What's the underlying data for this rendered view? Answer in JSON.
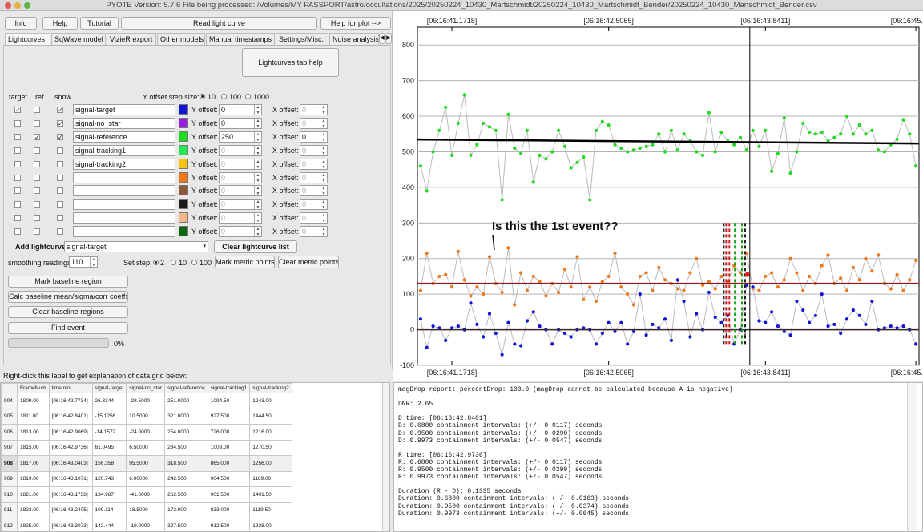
{
  "window": {
    "title": "PYOTE Version: 5.7.6  File being processed: /Volumes/MY PASSPORT/astro/occultations/2025/20250224_10430_Martschmidt/20250224_10430_Martschmidt_Bender/20250224_10430_Martschmidt_Bender.csv"
  },
  "toolbar": {
    "info": "Info",
    "help": "Help",
    "tutorial": "Tutorial",
    "read_lightcurve": "Read light curve",
    "help_for_plot": "Help for plot -->"
  },
  "tabs": [
    "Lightcurves",
    "SqWave model",
    "VizieR export",
    "Other models",
    "Manual timestamps",
    "Settings/Misc.",
    "Noise analysis/"
  ],
  "lightcurves_help": "Lightcurves tab help",
  "headers": {
    "target": "target",
    "ref": "ref",
    "show": "show",
    "y_offset_step": "Y offset step size:"
  },
  "y_step_options": [
    "10",
    "100",
    "1000"
  ],
  "rows": [
    {
      "name": "signal-target",
      "color": "#1414d8",
      "y_label": "Y offset:",
      "y": "0",
      "x_label": "X offset:",
      "x": "0",
      "target": true,
      "ref": false,
      "show": true
    },
    {
      "name": "signal-no_star",
      "color": "#9a1ee0",
      "y_label": "Y offset:",
      "y": "0",
      "x_label": "X offset:",
      "x": "0",
      "target": false,
      "ref": false,
      "show": true
    },
    {
      "name": "signal-reference",
      "color": "#1cdc1c",
      "y_label": "Y offset:",
      "y": "250",
      "x_label": "X offset:",
      "x": "0",
      "target": false,
      "ref": true,
      "show": true
    },
    {
      "name": "signal-tracking1",
      "color": "#22e855",
      "y_label": "Y offset:",
      "y": "0",
      "x_label": "X offset:",
      "x": "0",
      "target": false,
      "ref": false,
      "show": false
    },
    {
      "name": "signal-tracking2",
      "color": "#f2c40a",
      "y_label": "Y offset:",
      "y": "0",
      "x_label": "X offset:",
      "x": "0",
      "target": false,
      "ref": false,
      "show": false
    },
    {
      "name": "",
      "color": "#f07818",
      "y_label": "Y offset:",
      "y": "0",
      "x_label": "X offset:",
      "x": "0",
      "target": false,
      "ref": false,
      "show": false
    },
    {
      "name": "",
      "color": "#8a5a3a",
      "y_label": "Y offset:",
      "y": "0",
      "x_label": "X offset:",
      "x": "0",
      "target": false,
      "ref": false,
      "show": false
    },
    {
      "name": "",
      "color": "#1a1a1a",
      "y_label": "Y offset:",
      "y": "0",
      "x_label": "X offset:",
      "x": "0",
      "target": false,
      "ref": false,
      "show": false
    },
    {
      "name": "",
      "color": "#f6b88a",
      "y_label": "Y offset:",
      "y": "0",
      "x_label": "X offset:",
      "x": "0",
      "target": false,
      "ref": false,
      "show": false
    },
    {
      "name": "",
      "color": "#116611",
      "y_label": "Y offset:",
      "y": "0",
      "x_label": "X offset:",
      "x": "0",
      "target": false,
      "ref": false,
      "show": false
    }
  ],
  "add_lightcurve": {
    "label": "Add lightcurve",
    "value": "signal-target",
    "clear": "Clear lightcurve list"
  },
  "smoothing": {
    "label": "smoothing readings",
    "value": "110"
  },
  "set_step": {
    "label": "Set step:",
    "options": [
      "2",
      "10",
      "100"
    ]
  },
  "mark_metric": "Mark metric points",
  "clear_metric": "Clear metric points",
  "actions": {
    "mark_baseline": "Mark baseline region",
    "calc_baseline": "Calc baseline mean/sigma/corr coeffs",
    "clear_baseline": "Clear baseline regions",
    "find_event": "Find event",
    "progress": "0%"
  },
  "grid_hint": "Right-click this label to get explanation of data grid below:",
  "grid": {
    "columns": [
      "",
      "FrameNum",
      "timeInfo",
      "signal-target",
      "signal-no_star",
      "signal-reference",
      "signal-tracking1",
      "signal-tracking2"
    ],
    "rows": [
      [
        "904",
        "1809.00",
        "[06:16:42.7734]",
        "26.3344",
        "-28.5000",
        "251.0000",
        "1094.50",
        "1243.00"
      ],
      [
        "905",
        "1811.00",
        "[06:16:42.8401]",
        "-15.1256",
        "10.5000",
        "321.0000",
        "927.500",
        "1444.50"
      ],
      [
        "906",
        "1813.00",
        "[06:16:42.9069]",
        "-14.1572",
        "-24.0000",
        "254.0000",
        "726.000",
        "1216.00"
      ],
      [
        "907",
        "1815.00",
        "[06:16:42.9736]",
        "61.0495",
        "6.50000",
        "284.500",
        "1008.00",
        "1270.50"
      ],
      [
        "908",
        "1817.00",
        "[06:16:43.0403]",
        "156.358",
        "95.5000",
        "318.500",
        "865.000",
        "1256.00"
      ],
      [
        "909",
        "1819.00",
        "[06:16:43.1071]",
        "120.743",
        "6.00000",
        "242.500",
        "904.500",
        "1189.00"
      ],
      [
        "910",
        "1821.00",
        "[06:16:43.1738]",
        "134.987",
        "-41.0000",
        "262.500",
        "901.500",
        "1401.50"
      ],
      [
        "911",
        "1823.00",
        "[06:16:43.2405]",
        "109.114",
        "18.5000",
        "172.000",
        "833.000",
        "1119.50"
      ],
      [
        "912",
        "1825.00",
        "[06:16:43.3073]",
        "142.444",
        "-19.0000",
        "327.500",
        "912.500",
        "1238.00"
      ]
    ]
  },
  "report_lines": [
    "magDrop report: percentDrop: 100.0 (magDrop cannot be calculated because A is negative)",
    "",
    "DNR: 2.65",
    "",
    "D time: [06:16:42.8401]",
    "D: 0.6800 containment intervals: (+/- 0.0117) seconds",
    "D: 0.9500 containment intervals: (+/- 0.0290) seconds",
    "D: 0.9973 containment intervals: (+/- 0.0547) seconds",
    "",
    "R time: [06:16:42.9736]",
    "R: 0.6800 containment intervals: (+/- 0.0117) seconds",
    "R: 0.9500 containment intervals: (+/- 0.0290) seconds",
    "R: 0.9973 containment intervals: (+/- 0.0547) seconds",
    "",
    "Duration (R - D): 0.1335 seconds",
    "Duration: 0.6800 containment intervals: (+/- 0.0163) seconds",
    "Duration: 0.9500 containment intervals: (+/- 0.0374) seconds",
    "Duration: 0.9973 containment intervals: (+/- 0.0645) seconds"
  ],
  "chart_data": {
    "type": "line",
    "ylim": [
      -100,
      850
    ],
    "yticks": [
      "800",
      "700",
      "600",
      "500",
      "400",
      "300",
      "200",
      "100",
      "0",
      "-100"
    ],
    "xtick_labels": [
      "[06:16:41.1718]",
      "[06:16:42.5065]",
      "[06:16:43.8411]",
      "[06:16:45.1758]"
    ],
    "annotation": "Is this the 1st event??",
    "frames": 80,
    "cursor_frame": 52,
    "baseline_level_ref": 530,
    "baseline_level_orange": 130,
    "baseline_level_target": 0,
    "series": [
      {
        "name": "signal-reference",
        "color": "#1cdc1c",
        "values": [
          460,
          390,
          500,
          560,
          625,
          490,
          580,
          660,
          490,
          520,
          580,
          570,
          560,
          365,
          605,
          510,
          495,
          560,
          415,
          490,
          480,
          500,
          560,
          515,
          455,
          470,
          485,
          365,
          560,
          585,
          575,
          520,
          510,
          500,
          505,
          510,
          515,
          520,
          550,
          500,
          560,
          505,
          550,
          530,
          500,
          490,
          610,
          500,
          555,
          530,
          520,
          540,
          505,
          560,
          515,
          560,
          445,
          495,
          595,
          440,
          500,
          580,
          555,
          550,
          555,
          530,
          540,
          550,
          600,
          550,
          575,
          550,
          560,
          505,
          500,
          520,
          535,
          590,
          550,
          460
        ]
      },
      {
        "name": "orange",
        "color": "#f07818",
        "values": [
          110,
          215,
          130,
          150,
          155,
          120,
          220,
          140,
          95,
          120,
          100,
          205,
          130,
          105,
          230,
          70,
          160,
          110,
          150,
          135,
          95,
          130,
          105,
          170,
          120,
          205,
          85,
          120,
          80,
          135,
          150,
          215,
          120,
          100,
          70,
          150,
          160,
          110,
          175,
          140,
          130,
          115,
          110,
          160,
          200,
          125,
          135,
          115,
          150,
          135,
          180,
          160,
          215,
          115,
          110,
          150,
          160,
          120,
          140,
          200,
          160,
          110,
          150,
          130,
          180,
          210,
          130,
          145,
          110,
          175,
          140,
          200,
          165,
          210,
          130,
          115,
          155,
          110,
          140,
          195
        ]
      },
      {
        "name": "signal-target",
        "color": "#1414d8",
        "values": [
          30,
          -50,
          10,
          5,
          -30,
          5,
          10,
          0,
          75,
          15,
          -20,
          45,
          -10,
          -70,
          20,
          -40,
          -45,
          25,
          50,
          10,
          0,
          -40,
          0,
          -10,
          -20,
          0,
          5,
          0,
          -40,
          -10,
          20,
          -5,
          20,
          -40,
          -5,
          100,
          -15,
          15,
          5,
          30,
          -30,
          140,
          80,
          -20,
          45,
          0,
          105,
          35,
          20,
          40,
          -40,
          0,
          125,
          120,
          25,
          20,
          50,
          10,
          -5,
          -15,
          80,
          55,
          20,
          40,
          100,
          10,
          15,
          -10,
          30,
          55,
          40,
          15,
          80,
          0,
          5,
          10,
          5,
          10,
          0,
          -40
        ]
      }
    ]
  }
}
